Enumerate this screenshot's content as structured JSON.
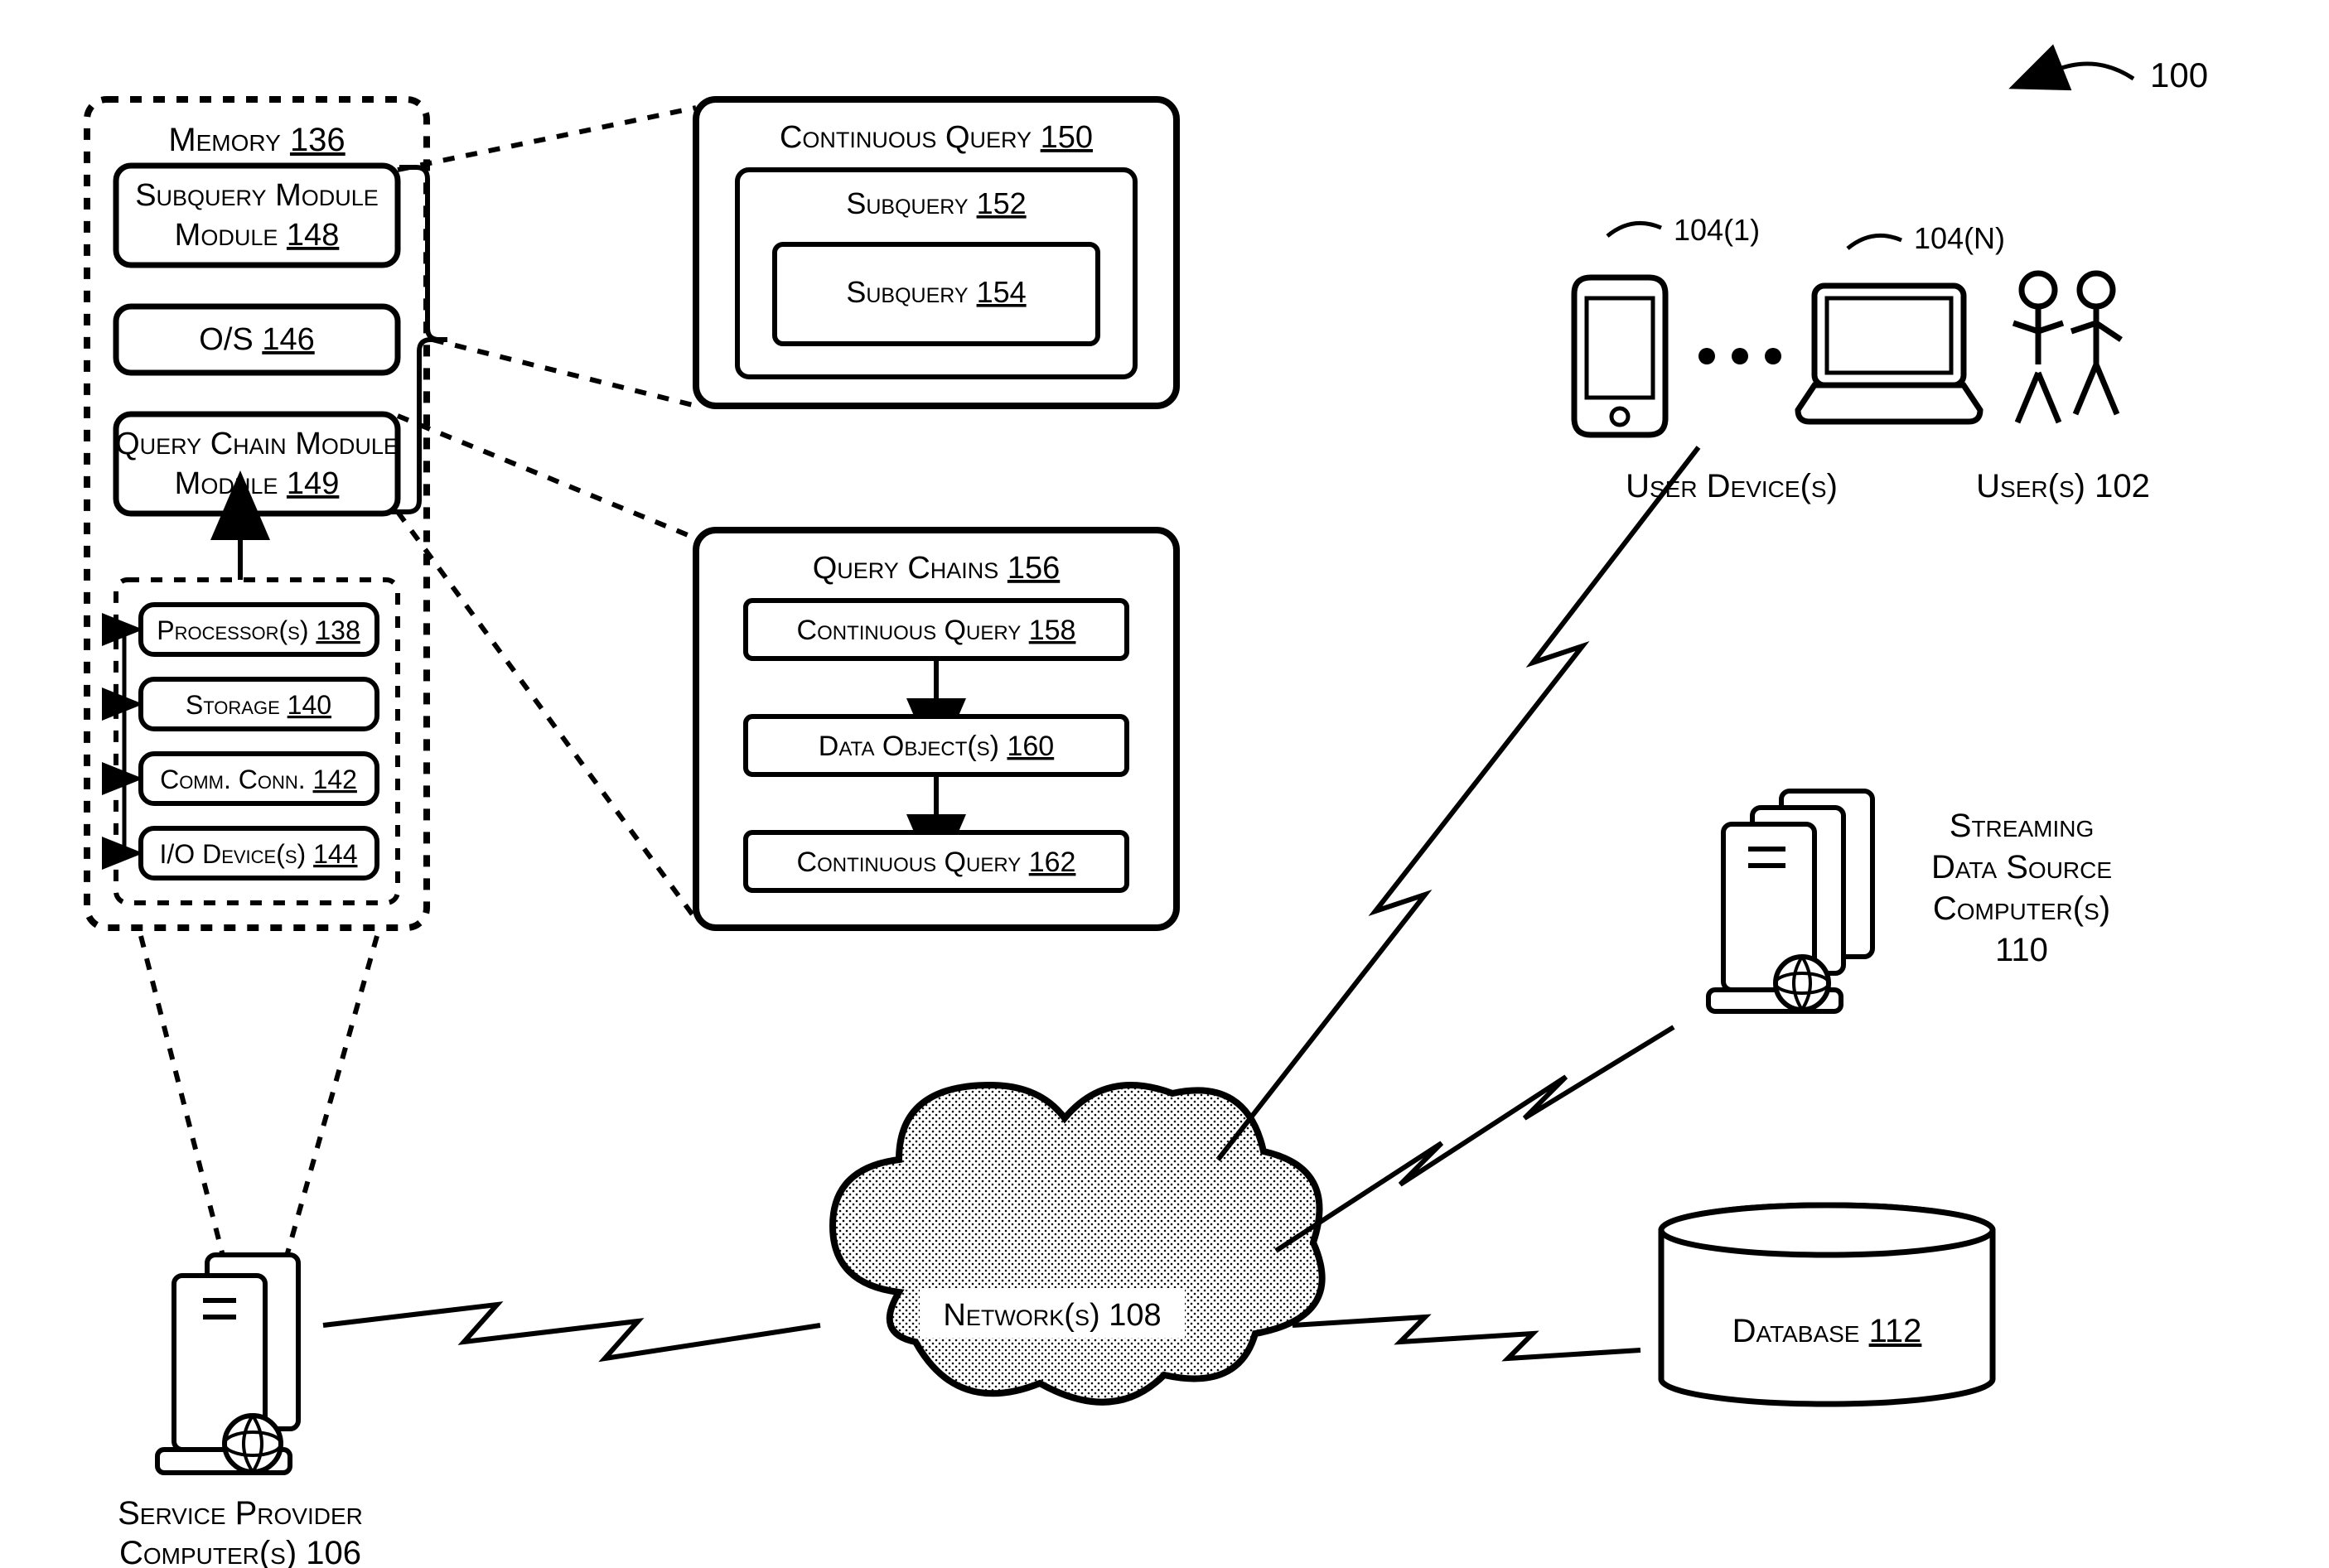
{
  "figure": {
    "number_label": "100"
  },
  "memory": {
    "title": "Memory",
    "number": "136",
    "subquery_module": {
      "title": "Subquery Module",
      "number": "148"
    },
    "os": {
      "title": "O/S",
      "number": "146"
    },
    "query_chain_module": {
      "title": "Query Chain Module",
      "number": "149"
    },
    "components": {
      "processor": {
        "title": "Processor(s)",
        "number": "138"
      },
      "storage": {
        "title": "Storage",
        "number": "140"
      },
      "comm_conn": {
        "title": "Comm. Conn.",
        "number": "142"
      },
      "io_devices": {
        "title": "I/O Device(s)",
        "number": "144"
      }
    }
  },
  "continuous_query": {
    "title": "Continuous Query",
    "number": "150",
    "subquery_outer": {
      "title": "Subquery",
      "number": "152"
    },
    "subquery_inner": {
      "title": "Subquery",
      "number": "154"
    }
  },
  "query_chains": {
    "title": "Query Chains",
    "number": "156",
    "cq1": {
      "title": "Continuous Query",
      "number": "158"
    },
    "data_obj": {
      "title": "Data Object(s)",
      "number": "160"
    },
    "cq2": {
      "title": "Continuous Query",
      "number": "162"
    }
  },
  "user_devices": {
    "label": "User Device(s)",
    "device_1": "104(1)",
    "device_n": "104(N)"
  },
  "users": {
    "label": "User(s)",
    "number": "102"
  },
  "streaming": {
    "label_line1": "Streaming",
    "label_line2": "Data Source",
    "label_line3": "Computer(s)",
    "number": "110"
  },
  "database": {
    "label": "Database",
    "number": "112"
  },
  "network": {
    "label": "Network(s)",
    "number": "108"
  },
  "service_provider": {
    "label_line1": "Service Provider",
    "label_line2": "Computer(s)",
    "number": "106"
  }
}
